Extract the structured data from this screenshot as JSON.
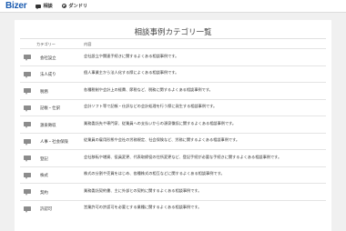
{
  "header": {
    "logo": "Bizer",
    "nav": [
      {
        "label": "相談",
        "icon": "chat-icon"
      },
      {
        "label": "ダンドリ",
        "icon": "check-circle-icon"
      }
    ]
  },
  "main": {
    "title": "相談事例カテゴリ一覧",
    "columns": [
      "カテゴリー",
      "内容"
    ],
    "categories": [
      {
        "name": "会社設立",
        "description": "会社設立や関連手続きに関するよくある相談事例です。"
      },
      {
        "name": "法人成り",
        "description": "個人事業主から法人化する際によくある相談事例です。"
      },
      {
        "name": "税務",
        "description": "各種税制や会計上の経費、節税など、税務に関するよくある相談事例です。"
      },
      {
        "name": "記帳・仕訳",
        "description": "会計ソフト等で記帳・仕訳などの会計処理を行う際に発生する相談事例です。"
      },
      {
        "name": "源泉徴収",
        "description": "業務委託先や専門家、従業員への支払いからの源泉徴収に関するよくある相談事例です。"
      },
      {
        "name": "人事・社会保険",
        "description": "従業員の雇用形態や会社の労務規定、社会保険など、労務に関するよくある相談事例です。"
      },
      {
        "name": "登記",
        "description": "会社移転や増資、役員変更、代表取締役の住所変更など、登記手続が必要な手続きに関するよくある相談事例です。"
      },
      {
        "name": "株式",
        "description": "株式の分割や売買をはじめ、各種株式の相互などに関するよくある相談事例です。"
      },
      {
        "name": "契約",
        "description": "業務委託契約書、主に外部との契約に関するよくある相談事例です。"
      },
      {
        "name": "許認可",
        "description": "営業許可の許認可を必要とする業種に関するよくある相談事例です。"
      }
    ]
  }
}
